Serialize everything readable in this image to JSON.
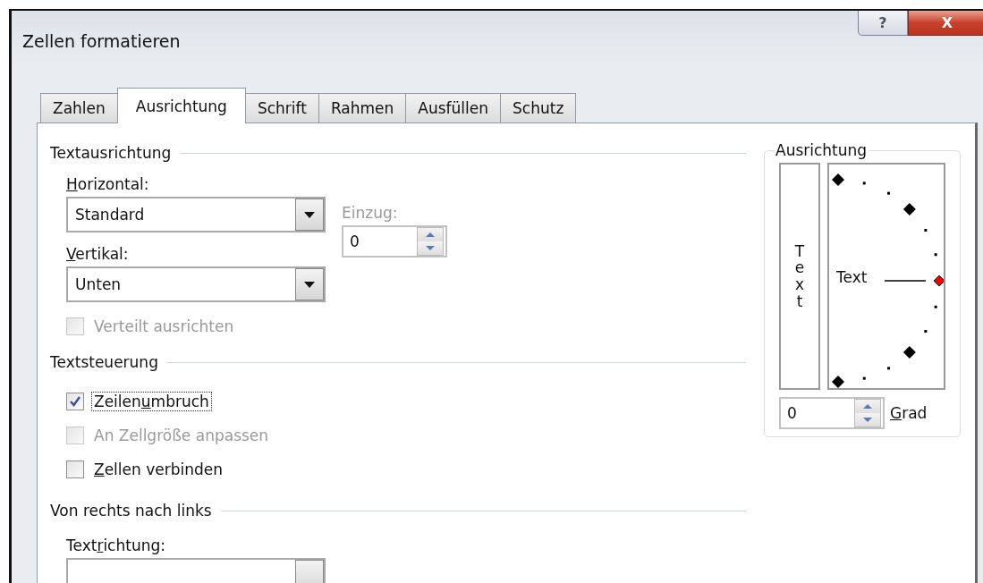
{
  "window": {
    "title": "Zellen formatieren",
    "buttons": [
      {
        "kind": "help",
        "label": "?"
      },
      {
        "kind": "close",
        "label": "X"
      }
    ]
  },
  "tabs": [
    {
      "label": "Zahlen",
      "selected": false
    },
    {
      "label": "Ausrichtung",
      "selected": true
    },
    {
      "label": "Schrift",
      "selected": false
    },
    {
      "label": "Rahmen",
      "selected": false
    },
    {
      "label": "Ausfüllen",
      "selected": false
    },
    {
      "label": "Schutz",
      "selected": false
    }
  ],
  "text_alignment": {
    "title": "Textausrichtung",
    "horizontal": {
      "label_parts": {
        "key": "H",
        "after": "orizontal:"
      },
      "value": "Standard"
    },
    "vertical": {
      "label_parts": {
        "key": "V",
        "after": "ertikal:"
      },
      "value": "Unten"
    },
    "indent": {
      "label": "Einzug:",
      "value": "0",
      "disabled": true
    },
    "distributed": {
      "label": "Verteilt ausrichten",
      "checked": false,
      "disabled": true
    }
  },
  "text_control": {
    "title": "Textsteuerung",
    "options": [
      {
        "label_parts": {
          "before": "Zeilen",
          "key": "u",
          "after": "mbruch"
        },
        "checked": true,
        "disabled": false,
        "focused": true
      },
      {
        "label": "An Zellgröße anpassen",
        "checked": false,
        "disabled": true,
        "focused": false
      },
      {
        "label_parts": {
          "key": "Z",
          "after": "ellen verbinden"
        },
        "checked": false,
        "disabled": false,
        "focused": false
      }
    ]
  },
  "right_to_left": {
    "title": "Von rechts nach links",
    "direction": {
      "label_parts": {
        "before": "Text",
        "key": "r",
        "after": "ichtung:"
      }
    }
  },
  "orientation": {
    "title": "Ausrichtung",
    "vertical_text": "Text",
    "dial_text": "Text",
    "degrees": {
      "value": "0",
      "label_parts": {
        "key": "G",
        "after": "rad"
      }
    }
  }
}
